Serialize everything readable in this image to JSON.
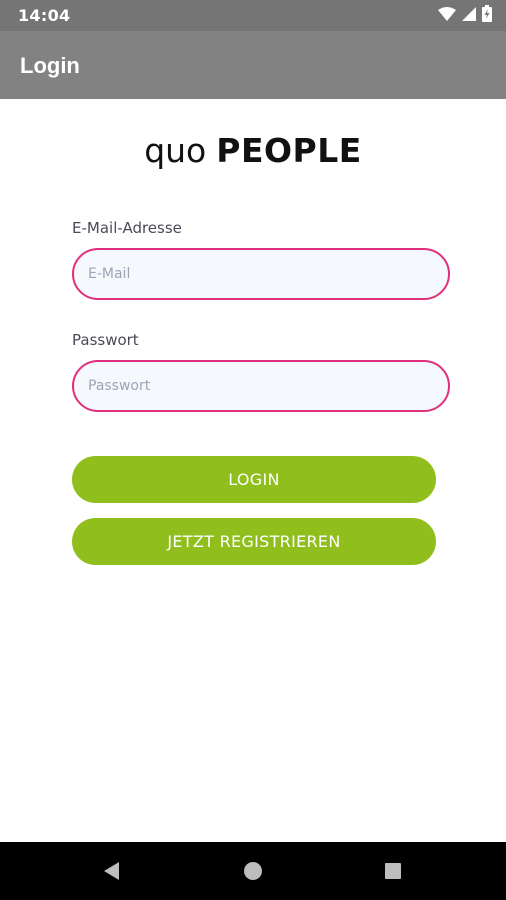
{
  "status_bar": {
    "time": "14:04",
    "icons": [
      "wifi-icon",
      "signal-icon",
      "battery-charging-icon"
    ]
  },
  "app_bar": {
    "title": "Login"
  },
  "logo": {
    "light": "quo",
    "bold": "PEOPLE"
  },
  "form": {
    "email": {
      "label": "E-Mail-Adresse",
      "placeholder": "E-Mail",
      "value": ""
    },
    "password": {
      "label": "Passwort",
      "placeholder": "Passwort",
      "value": ""
    },
    "login_button": "LOGIN",
    "register_button": "JETZT REGISTRIEREN"
  },
  "nav_bar": {
    "icons": [
      "back-icon",
      "home-icon",
      "recents-icon"
    ]
  },
  "colors": {
    "status_bar": "#757575",
    "app_bar": "#828282",
    "input_border": "#e0307d",
    "button": "#8fbe1d"
  }
}
